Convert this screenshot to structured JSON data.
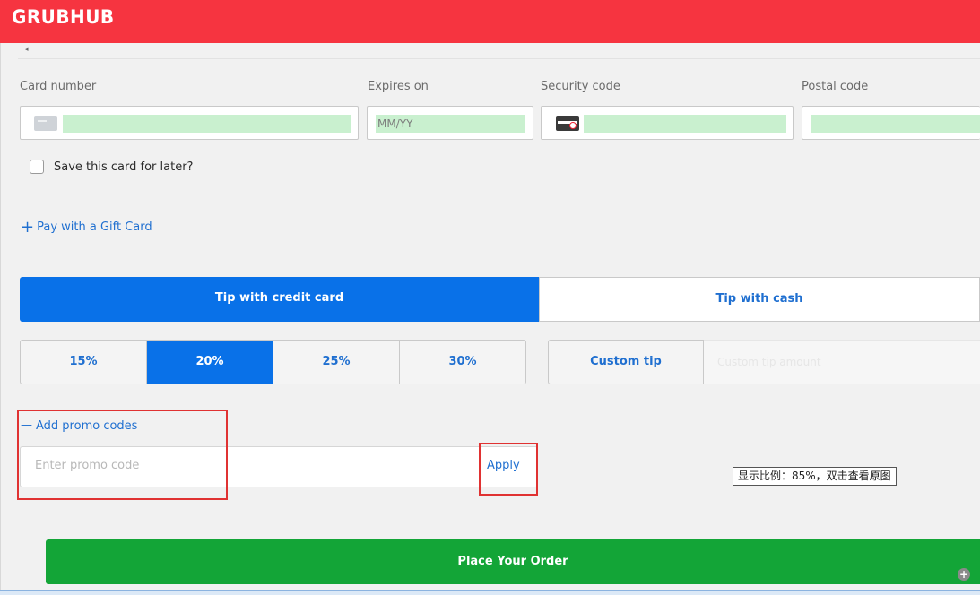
{
  "header": {
    "logo_text": "GRUBHUB",
    "brand_color": "#f63440"
  },
  "card_form": {
    "card_number_label": "Card number",
    "expires_label": "Expires on",
    "expires_placeholder": "MM/YY",
    "security_label": "Security code",
    "postal_label": "Postal code",
    "card_icon": "credit-card-icon",
    "cvv_icon": "card-security-code-icon",
    "save_card_label": "Save this card for later?"
  },
  "gift_card": {
    "icon": "plus-icon",
    "label": "Pay with a Gift Card"
  },
  "tip": {
    "tabs": [
      {
        "label": "Tip with credit card",
        "active": true
      },
      {
        "label": "Tip with cash",
        "active": false
      }
    ],
    "percentages": [
      {
        "label": "15%",
        "active": false
      },
      {
        "label": "20%",
        "active": true
      },
      {
        "label": "25%",
        "active": false
      },
      {
        "label": "30%",
        "active": false
      }
    ],
    "custom_label": "Custom tip",
    "custom_placeholder": "Custom tip amount",
    "accent_color": "#0971e8"
  },
  "promo": {
    "toggle_icon": "minus-icon",
    "toggle_label": "Add promo codes",
    "placeholder": "Enter promo code",
    "apply_label": "Apply"
  },
  "overlay": {
    "zoom_note": "显示比例：85%，双击查看原图",
    "zoom_icon": "zoom-in-icon"
  },
  "order": {
    "place_label": "Place Your Order",
    "button_color": "#13a537"
  }
}
